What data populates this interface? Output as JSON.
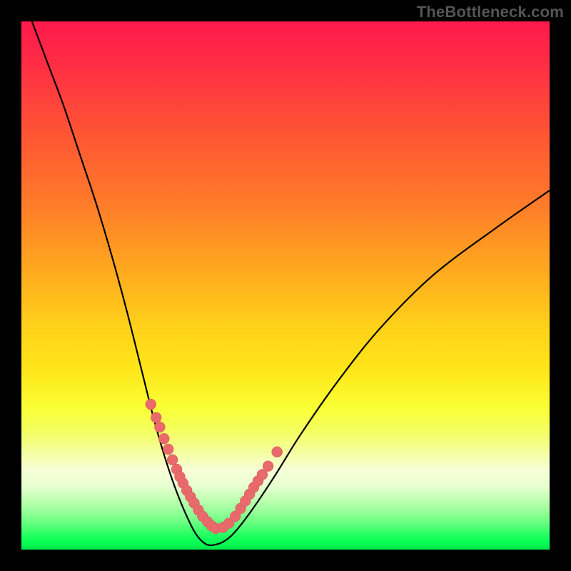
{
  "watermark": "TheBottleneck.com",
  "colors": {
    "background": "#000000",
    "watermark_text": "#555555",
    "curve_stroke": "#000000",
    "marker_fill": "#e86a6a",
    "marker_stroke": "#d85a5a",
    "gradient_top": "#ff1a4d",
    "gradient_bottom": "#00e84a"
  },
  "chart_data": {
    "type": "line",
    "title": "",
    "xlabel": "",
    "ylabel": "",
    "xlim": [
      0,
      100
    ],
    "ylim": [
      0,
      100
    ],
    "note": "No axes, ticks, or labels are rendered. The background is a vertical spectral gradient (red→orange→yellow→green). The black curve is a V-shaped bottleneck profile touching y≈0 near x≈35; y-values are percentages of plot height from bottom.",
    "series": [
      {
        "name": "bottleneck-curve",
        "x": [
          2,
          5,
          8,
          11,
          14,
          17,
          20,
          23,
          25,
          27,
          29,
          31,
          33,
          35,
          37,
          39,
          41,
          44,
          48,
          53,
          60,
          68,
          78,
          90,
          100
        ],
        "y": [
          100,
          92,
          84,
          75,
          66,
          56,
          45,
          33,
          25,
          18,
          12,
          7,
          3,
          1,
          1,
          2,
          4,
          8,
          14,
          22,
          32,
          42,
          52,
          61,
          68
        ]
      }
    ],
    "markers": {
      "name": "highlighted-points",
      "note": "Salmon circular markers along the lower part of both arms of the curve.",
      "x": [
        24.5,
        25.5,
        26.2,
        27.0,
        27.8,
        28.6,
        29.4,
        30.0,
        30.6,
        31.3,
        32.0,
        32.7,
        33.5,
        34.3,
        35.2,
        36.0,
        36.8,
        38.2,
        39.3,
        40.5,
        41.5,
        42.4,
        43.2,
        44.0,
        44.8,
        45.6,
        46.7,
        48.4
      ],
      "y": [
        27.5,
        25.0,
        23.2,
        21.0,
        19.0,
        17.0,
        15.2,
        13.8,
        12.6,
        11.2,
        10.0,
        8.8,
        7.5,
        6.3,
        5.3,
        4.5,
        4.0,
        4.2,
        5.0,
        6.3,
        7.8,
        9.2,
        10.5,
        11.8,
        13.0,
        14.2,
        15.8,
        18.5
      ]
    }
  }
}
